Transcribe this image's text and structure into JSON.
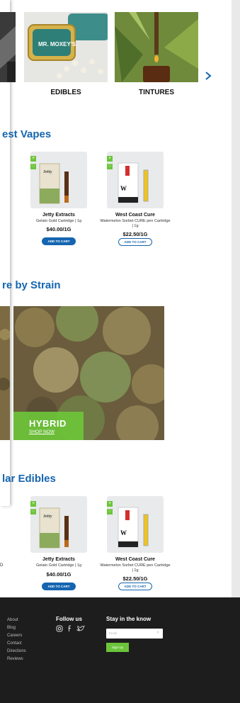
{
  "categories": [
    {
      "label": ""
    },
    {
      "label": "EDIBLES"
    },
    {
      "label": "TINTURES"
    }
  ],
  "sections": {
    "vapes_title": "est Vapes",
    "strain_title": "re by Strain",
    "edibles_title": "lar Edibles"
  },
  "vape_products": [
    {
      "brand": "Jetty Extracts",
      "desc": "Gelato Gold Cartridge | 1g",
      "price": "$40.00/1G",
      "button": "ADD TO CART"
    },
    {
      "brand": "West Coast Cure",
      "desc": "Watermelon Sorbet CURE pen Cartridge | 1g",
      "price": "$22.50/1G",
      "button": "ADD TO CART"
    }
  ],
  "edible_products": [
    {
      "brand": "Jetty Extracts",
      "desc": "Gelato Gold Cartridge | 1g",
      "price": "$40.00/1G",
      "button": "ADD TO CART"
    },
    {
      "brand": "West Coast Cure",
      "desc": "Watermelon Sorbet CURE pen Cartridge | 1g",
      "price": "$22.50/1G",
      "button": "ADD TO CART"
    }
  ],
  "partial_text": {
    "edible_left_fragment": "D"
  },
  "strain": {
    "title": "HYBRID",
    "link": "SHOP NOW"
  },
  "footer": {
    "links": [
      "About",
      "Blog",
      "Careers",
      "Contact",
      "Directions",
      "Reviews"
    ],
    "follow_title": "Follow us",
    "newsletter_title": "Stay in the know",
    "email_placeholder": "Email",
    "signup_label": "Sign Up"
  },
  "colors": {
    "accent_blue": "#1565b0",
    "accent_green": "#6cc43a",
    "footer_bg": "#1d1d1d"
  }
}
